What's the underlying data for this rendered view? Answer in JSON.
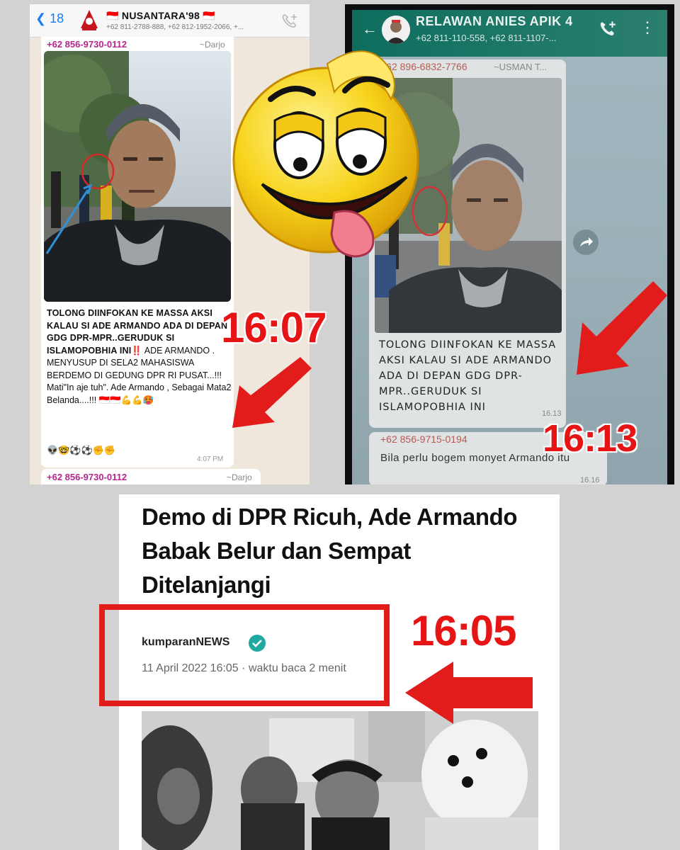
{
  "panel1": {
    "back_count": "18",
    "group_name": "🇮🇩 NUSANTARA'98 🇮🇩",
    "group_members": "+62 811-2788-888, +62 812-1952-2066, +...",
    "sender": "+62 856-9730-0112",
    "sender_alias": "~Darjo",
    "message_bold": "TOLONG DIINFOKAN KE MASSA AKSI KALAU SI ADE ARMANDO ADA DI DEPAN GDG DPR-MPR..GERUDUK SI ISLAMOPOBHIA INI",
    "message_marks": "‼️",
    "message_rest": " ADE ARMANDO . MENYUSUP DI SELA2 MAHASISWA BERDEMO DI GEDUNG DPR RI PUSAT...!!! Mati\"In aje tuh\". Ade Armando , Sebagai Mata2 Belanda....!!! 🇮🇩🇮🇩💪💪🥵",
    "message_emojis": "👽🤓⚽⚽✊✊",
    "time": "4:07 PM",
    "next_sender": "+62 856-9730-0112",
    "next_alias": "~Darjo"
  },
  "panel2": {
    "group_name": "RELAWAN ANIES APIK 4",
    "group_members": "+62 811-110-558, +62 811-1107-...",
    "sender": "+62 896-6832-7766",
    "sender_alias": "~USMAN T...",
    "message": "TOLONG DIINFOKAN KE MASSA AKSI KALAU SI ADE ARMANDO ADA DI DEPAN GDG DPR-MPR..GERUDUK SI ISLAMOPOBHIA INI",
    "time": "16.13",
    "next_sender": "+62 856-9715-0194",
    "next_message": "Bila perlu bogem monyet Armando itu",
    "next_time": "16.16"
  },
  "article": {
    "title": "Demo di DPR Ricuh, Ade Armando Babak Belur dan Sempat Ditelanjangi",
    "publisher": "kumparanNEWS",
    "date": "11 April 2022 16:05",
    "separator": "·",
    "read_time": "waktu baca 2 menit"
  },
  "annotations": {
    "time1": "16:07",
    "time2": "16:13",
    "time3": "16:05",
    "accent_red": "#e61414"
  },
  "icons": [
    "back-chevron-icon",
    "add-call-icon",
    "more-vert-icon",
    "forward-icon",
    "verified-check-icon",
    "laughing-emoji-sticker",
    "red-arrow-icon",
    "blue-arrow-icon",
    "red-circle-mark"
  ]
}
